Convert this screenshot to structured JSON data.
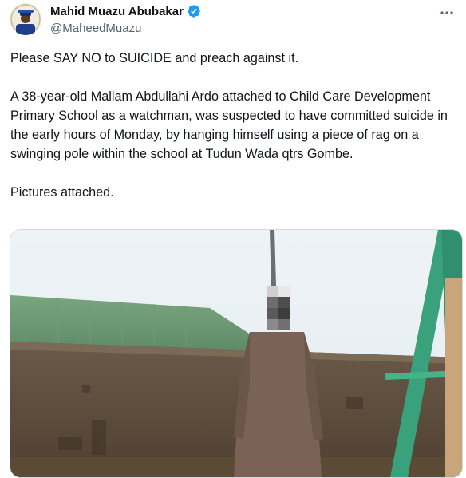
{
  "tweet": {
    "author": {
      "display_name": "Mahid Muazu Abubakar",
      "handle": "@MaheedMuazu",
      "verified_icon": "verified-badge-icon"
    },
    "more_icon": "more-options-icon",
    "paragraphs": [
      "Please SAY NO to SUICIDE and preach against it.",
      "A 38-year-old Mallam Abdullahi Ardo attached to Child Care Development Primary School as a watchman, was suspected to have committed suicide in the early hours of Monday, by hanging himself using a piece of rag on a swinging pole within the school at Tudun Wada qtrs Gombe.",
      "Pictures attached."
    ],
    "media": {
      "type": "photo"
    }
  },
  "colors": {
    "text": "#0f1419",
    "secondary_text": "#536471",
    "verified_blue": "#1d9bf0",
    "border": "#cfd9de"
  }
}
